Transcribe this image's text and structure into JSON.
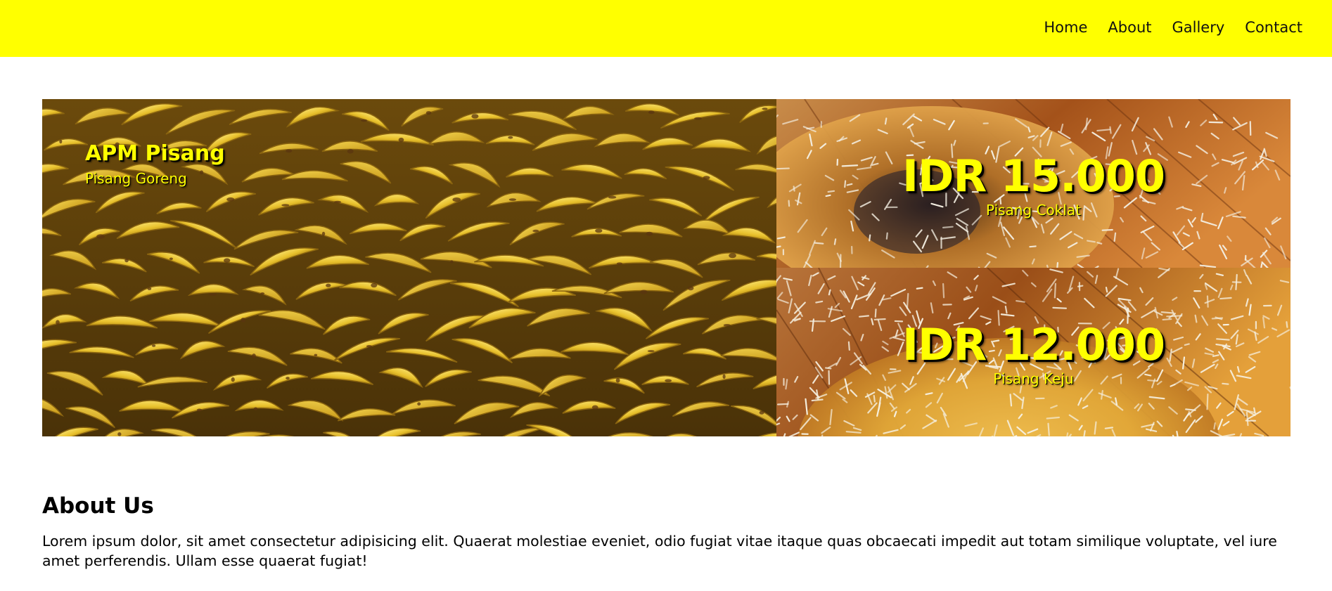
{
  "nav": {
    "links": [
      "Home",
      "About",
      "Gallery",
      "Contact"
    ]
  },
  "hero": {
    "title": "APM Pisang",
    "subtitle": "Pisang Goreng",
    "image_main": "banana-bunches-photo",
    "offers": [
      {
        "price": "IDR 15.000",
        "label": "Pisang Coklat",
        "image": "chocolate-banana-pancake-photo"
      },
      {
        "price": "IDR 12.000",
        "label": "Pisang Keju",
        "image": "cheese-banana-pancake-photo"
      }
    ]
  },
  "about": {
    "heading": "About Us",
    "text": "Lorem ipsum dolor, sit amet consectetur adipisicing elit. Quaerat molestiae eveniet, odio fugiat vitae itaque quas obcaecati impedit aut totam similique voluptate, vel iure amet perferendis. Ullam esse quaerat fugiat!"
  },
  "colors": {
    "navbar": "#ffff00",
    "accent_text": "#ffff00",
    "banana": "#e8c22f",
    "wood": "#b8651a"
  }
}
